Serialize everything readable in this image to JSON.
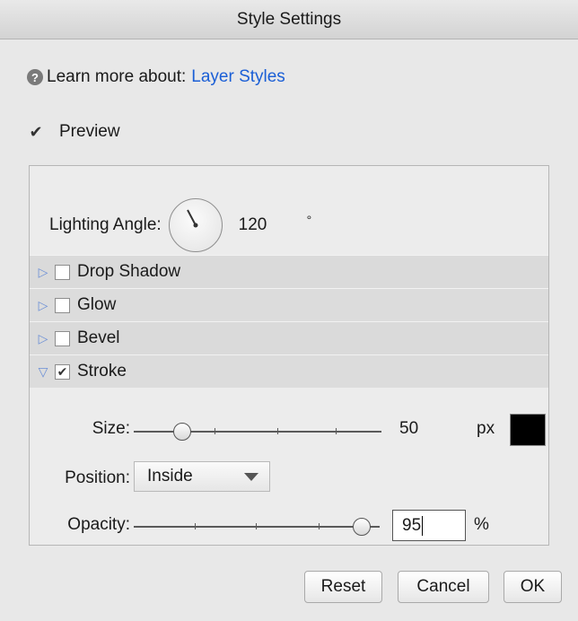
{
  "window": {
    "title": "Style Settings"
  },
  "learn": {
    "prefix": "Learn more about:",
    "link": "Layer Styles",
    "icon": "help-icon"
  },
  "preview": {
    "label": "Preview",
    "checked": true
  },
  "lighting": {
    "label": "Lighting Angle:",
    "value": "120",
    "unit": "°"
  },
  "effects": [
    {
      "label": "Drop Shadow",
      "checked": false,
      "expanded": false
    },
    {
      "label": "Glow",
      "checked": false,
      "expanded": false
    },
    {
      "label": "Bevel",
      "checked": false,
      "expanded": false
    },
    {
      "label": "Stroke",
      "checked": true,
      "expanded": true
    }
  ],
  "stroke": {
    "size": {
      "label": "Size:",
      "value": "50",
      "unit": "px",
      "slider_fraction": 0.2
    },
    "color": "#000000",
    "position": {
      "label": "Position:",
      "value": "Inside"
    },
    "opacity": {
      "label": "Opacity:",
      "value": "95",
      "unit": "%",
      "slider_fraction": 0.95
    }
  },
  "buttons": {
    "reset": "Reset",
    "cancel": "Cancel",
    "ok": "OK"
  },
  "colors": {
    "accent_link": "#1b5fd6",
    "disclosure": "#6b8fd6"
  }
}
